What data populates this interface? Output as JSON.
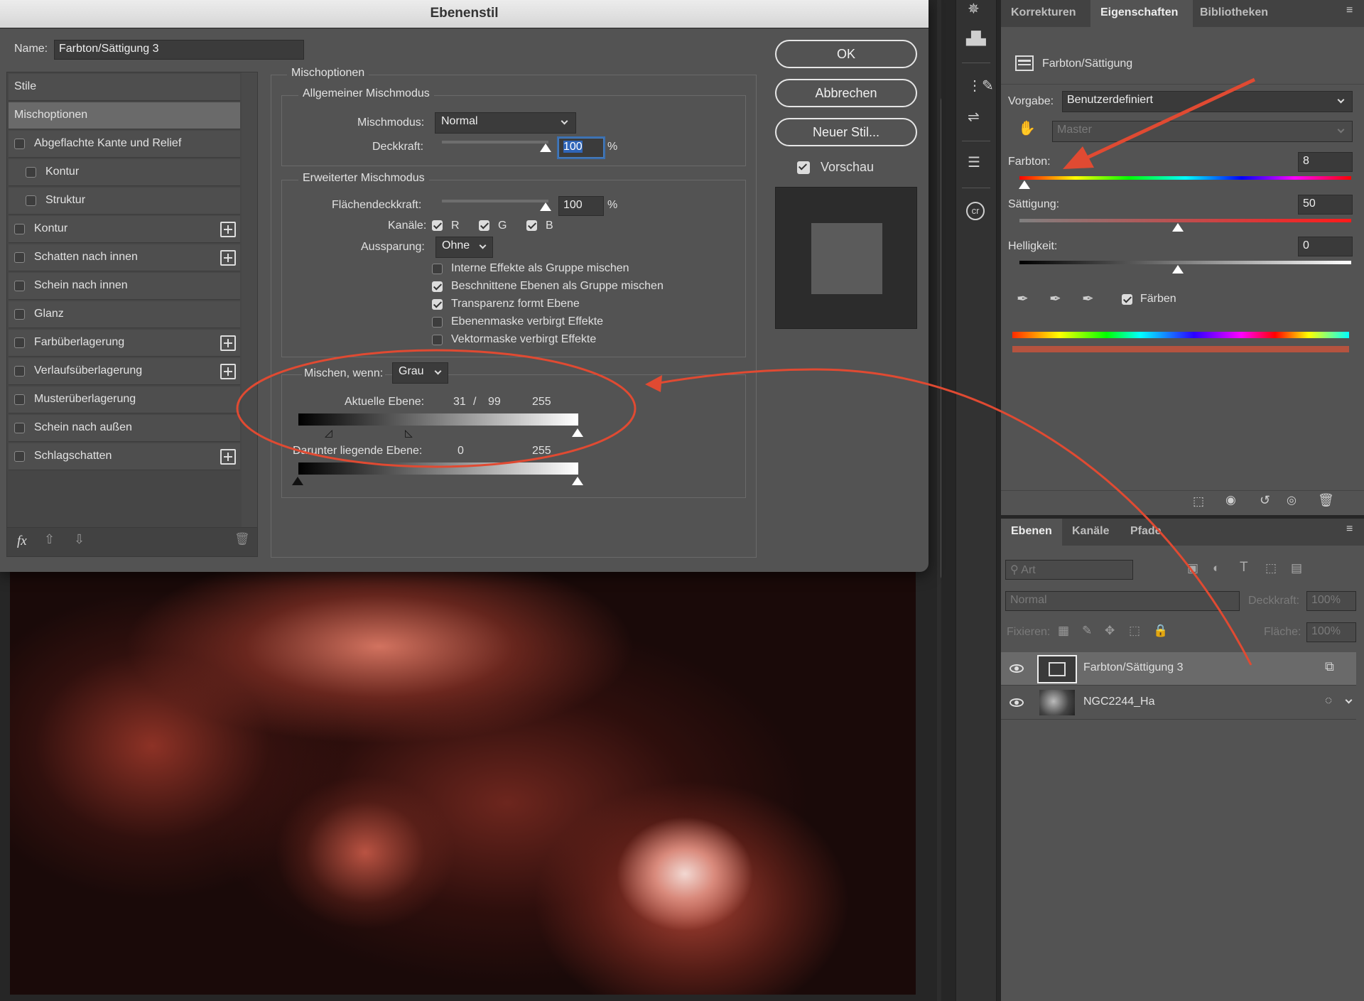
{
  "dialog": {
    "title": "Ebenenstil",
    "name_label": "Name:",
    "name_value": "Farbton/Sättigung 3",
    "styles": [
      {
        "label": "Stile",
        "type": "header"
      },
      {
        "label": "Mischoptionen",
        "type": "selected"
      },
      {
        "label": "Abgeflachte Kante und Relief",
        "checkbox": true,
        "plus": false
      },
      {
        "label": "Kontur",
        "checkbox": true,
        "plus": false,
        "indent": true
      },
      {
        "label": "Struktur",
        "checkbox": true,
        "plus": false,
        "indent": true
      },
      {
        "label": "Kontur",
        "checkbox": true,
        "plus": true
      },
      {
        "label": "Schatten nach innen",
        "checkbox": true,
        "plus": true
      },
      {
        "label": "Schein nach innen",
        "checkbox": true,
        "plus": false
      },
      {
        "label": "Glanz",
        "checkbox": true,
        "plus": false
      },
      {
        "label": "Farbüberlagerung",
        "checkbox": true,
        "plus": true
      },
      {
        "label": "Verlaufsüberlagerung",
        "checkbox": true,
        "plus": true
      },
      {
        "label": "Musterüberlagerung",
        "checkbox": true,
        "plus": false
      },
      {
        "label": "Schein nach außen",
        "checkbox": true,
        "plus": false
      },
      {
        "label": "Schlagschatten",
        "checkbox": true,
        "plus": true
      }
    ],
    "footer_fx": "fx",
    "mischoptionen": "Mischoptionen",
    "allgemein": {
      "title": "Allgemeiner Mischmodus",
      "mode_label": "Mischmodus:",
      "mode_value": "Normal",
      "opacity_label": "Deckkraft:",
      "opacity_value": "100",
      "pct": "%"
    },
    "erweitert": {
      "title": "Erweiterter Mischmodus",
      "fill_label": "Flächendeckkraft:",
      "fill_value": "100",
      "pct": "%",
      "channels_label": "Kanäle:",
      "ch_r": "R",
      "ch_g": "G",
      "ch_b": "B",
      "knockout_label": "Aussparung:",
      "knockout_value": "Ohne",
      "options": [
        {
          "label": "Interne Effekte als Gruppe mischen",
          "checked": false
        },
        {
          "label": "Beschnittene Ebenen als Gruppe mischen",
          "checked": true
        },
        {
          "label": "Transparenz formt Ebene",
          "checked": true
        },
        {
          "label": "Ebenenmaske verbirgt Effekte",
          "checked": false
        },
        {
          "label": "Vektormaske verbirgt Effekte",
          "checked": false
        }
      ]
    },
    "blendif": {
      "label": "Mischen, wenn:",
      "value": "Grau",
      "current_label": "Aktuelle Ebene:",
      "current_low": "31",
      "current_sep": "/",
      "current_mid": "99",
      "current_high": "255",
      "under_label": "Darunter liegende Ebene:",
      "under_low": "0",
      "under_high": "255"
    },
    "buttons": {
      "ok": "OK",
      "cancel": "Abbrechen",
      "new_style": "Neuer Stil..."
    },
    "preview_label": "Vorschau"
  },
  "properties": {
    "tabs": [
      "Korrekturen",
      "Eigenschaften",
      "Bibliotheken"
    ],
    "active_tab": "Eigenschaften",
    "adj_title": "Farbton/Sättigung",
    "preset_label": "Vorgabe:",
    "preset_value": "Benutzerdefiniert",
    "channel_value": "Master",
    "hue_label": "Farbton:",
    "hue_value": "8",
    "sat_label": "Sättigung:",
    "sat_value": "50",
    "light_label": "Helligkeit:",
    "light_value": "0",
    "colorize_label": "Färben"
  },
  "layers": {
    "tabs": [
      "Ebenen",
      "Kanäle",
      "Pfade"
    ],
    "active_tab": "Ebenen",
    "filter_placeholder": "Art",
    "blend_value": "Normal",
    "opacity_label": "Deckkraft:",
    "opacity_value": "100%",
    "lock_label": "Fixieren:",
    "fill_label": "Fläche:",
    "fill_value": "100%",
    "items": [
      {
        "name": "Farbton/Sättigung 3",
        "selected": true
      },
      {
        "name": "NGC2244_Ha",
        "selected": false
      }
    ]
  },
  "colors": {
    "annotation": "#e04a32",
    "dialog_bg": "#535353",
    "panel_bg": "#535353"
  }
}
